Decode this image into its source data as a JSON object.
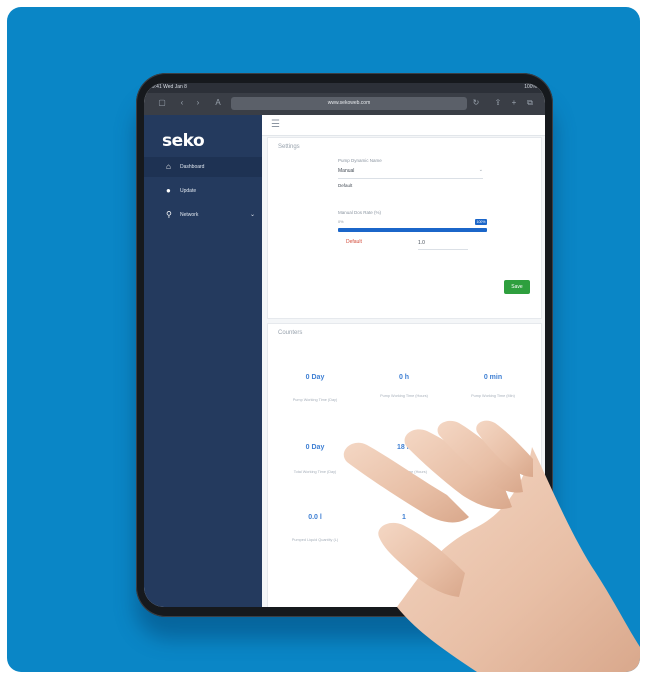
{
  "browser": {
    "status_time": "9:41 Wed Jan 8",
    "status_right": "100%",
    "url": "www.sekoweb.com"
  },
  "sidebar": {
    "logo": "seko",
    "items": [
      {
        "icon": "dashboard-icon",
        "label": "Dashboard",
        "active": true
      },
      {
        "icon": "user-icon",
        "label": "Update"
      },
      {
        "icon": "network-icon",
        "label": "Network",
        "chevron": "⌄"
      }
    ]
  },
  "settings_card": {
    "title": "Settings",
    "field1": {
      "label": "Pump Dynamic Name",
      "value": "Manual",
      "caption": "Default"
    },
    "field2": {
      "label": "Manual Dos Rate (%)",
      "range_min": "0%",
      "range_max": "100%",
      "default_label": "Default",
      "default_value": "1.0"
    },
    "save_label": "Save"
  },
  "counters_card": {
    "title": "Counters",
    "metrics": [
      {
        "value": "0 Day",
        "label": "Pump Working Time (Day)"
      },
      {
        "value": "0 h",
        "label": "Pump Working Time (Hours)"
      },
      {
        "value": "0 min",
        "label": "Pump Working Time (Min)"
      },
      {
        "value": "0 Day",
        "label": "Total Working Time (Day)"
      },
      {
        "value": "18 h",
        "label": "Total Working Time (Hours)"
      },
      {
        "value": "",
        "label": ""
      },
      {
        "value": "0.0 l",
        "label": "Pumped Liquid Quantity (L)"
      },
      {
        "value": "1",
        "label": "Pump..."
      }
    ]
  },
  "colors": {
    "background": "#0a86c6",
    "sidebar": "#243a5e",
    "accent": "#1b66c9",
    "save": "#2e9f3e"
  }
}
